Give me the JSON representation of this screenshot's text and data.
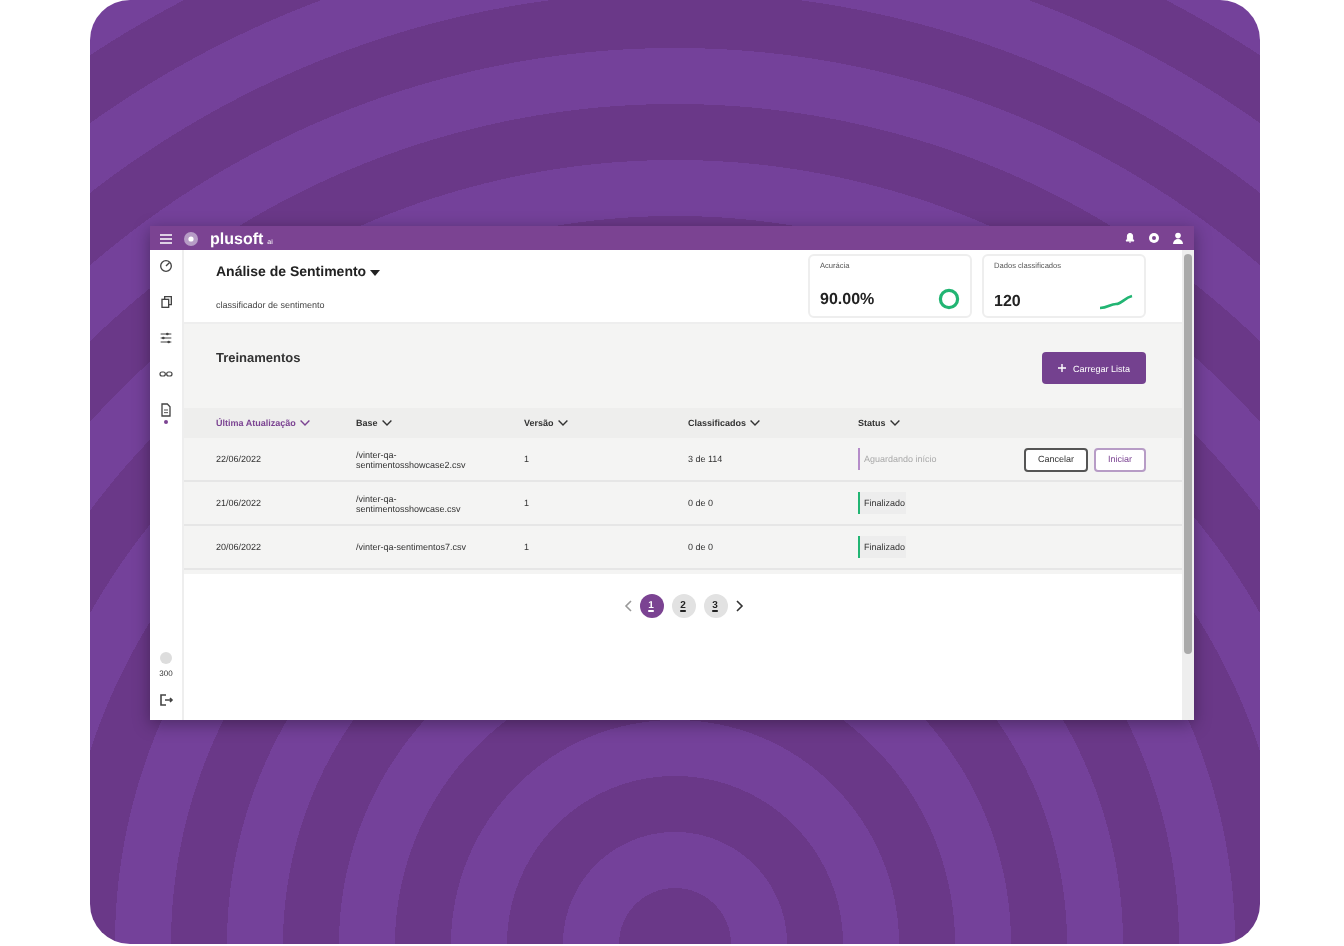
{
  "topbar": {
    "brand": "plusoft",
    "brand_suffix": "ai"
  },
  "sidebar": {
    "items": [
      {
        "kind": "gauge",
        "selected": false
      },
      {
        "kind": "files",
        "selected": false
      },
      {
        "kind": "sliders",
        "selected": false
      },
      {
        "kind": "link",
        "selected": false
      },
      {
        "kind": "document",
        "selected": true
      }
    ],
    "credits": "300"
  },
  "header": {
    "title": "Análise de Sentimento",
    "subtitle": "classificador de sentimento"
  },
  "metrics": [
    {
      "kind": "ring",
      "label": "Acurácia",
      "value": "90.00%"
    },
    {
      "kind": "trend",
      "label": "Dados classificados",
      "value": "120"
    }
  ],
  "section": {
    "title": "Treinamentos",
    "button": "Carregar Lista"
  },
  "table": {
    "columns": [
      {
        "label": "Última Atualização",
        "selected": true
      },
      {
        "label": "Base",
        "selected": false
      },
      {
        "label": "Versão",
        "selected": false
      },
      {
        "label": "Classificados",
        "selected": false
      },
      {
        "label": "Status",
        "selected": false
      }
    ],
    "rows": [
      {
        "cells": [
          "22/06/2022",
          "/vinter-qa-sentimentosshowcase2.csv",
          "1",
          "3 de 114"
        ],
        "status": {
          "label": "Aguardando início",
          "kind": "pending"
        },
        "actions": [
          {
            "label": "Cancelar",
            "kind": "neutral"
          },
          {
            "label": "Iniciar",
            "kind": "primary"
          }
        ]
      },
      {
        "cells": [
          "21/06/2022",
          "/vinter-qa-sentimentosshowcase.csv",
          "1",
          "0 de 0"
        ],
        "status": {
          "label": "Finalizado",
          "kind": "done"
        },
        "actions": []
      },
      {
        "cells": [
          "20/06/2022",
          "/vinter-qa-sentimentos7.csv",
          "1",
          "0 de 0"
        ],
        "status": {
          "label": "Finalizado",
          "kind": "done"
        },
        "actions": []
      }
    ]
  },
  "pagination": {
    "pages": [
      {
        "label": "1",
        "selected": true
      },
      {
        "label": "2",
        "selected": false
      },
      {
        "label": "3",
        "selected": false
      }
    ]
  }
}
